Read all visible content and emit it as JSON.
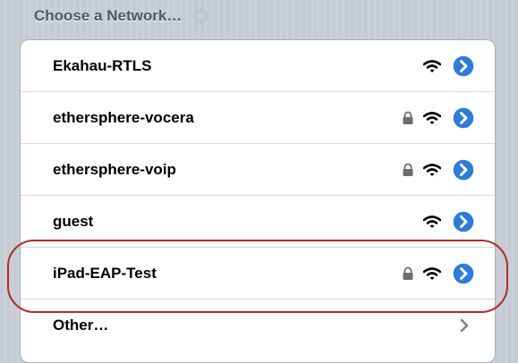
{
  "header": {
    "title": "Choose a Network…"
  },
  "networks": [
    {
      "name": "Ekahau-RTLS"
    },
    {
      "name": "ethersphere-vocera"
    },
    {
      "name": "ethersphere-voip"
    },
    {
      "name": "guest"
    },
    {
      "name": "iPad-EAP-Test"
    }
  ],
  "other": {
    "label": "Other…"
  },
  "colors": {
    "detail_button": "#2f7bd9",
    "highlight": "#b52a2a",
    "background": "#c5ccd4"
  }
}
